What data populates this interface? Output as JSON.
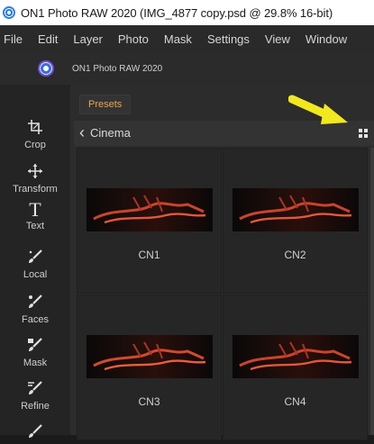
{
  "window": {
    "title": "ON1 Photo RAW 2020 (IMG_4877 copy.psd @ 29.8% 16-bit)"
  },
  "menu": {
    "items": [
      "File",
      "Edit",
      "Layer",
      "Photo",
      "Mask",
      "Settings",
      "View",
      "Window"
    ]
  },
  "app_header": {
    "name": "ON1 Photo RAW 2020"
  },
  "tools": [
    {
      "label": "Crop",
      "icon": "crop-icon"
    },
    {
      "label": "Transform",
      "icon": "transform-icon"
    },
    {
      "label": "Text",
      "icon": "text-icon"
    },
    {
      "label": "Local",
      "icon": "local-brush-icon"
    },
    {
      "label": "Faces",
      "icon": "faces-icon"
    },
    {
      "label": "Mask",
      "icon": "mask-brush-icon"
    },
    {
      "label": "Refine",
      "icon": "refine-brush-icon"
    }
  ],
  "panel": {
    "tab_label": "Presets",
    "category": "Cinema",
    "accent_color": "#e7a94a",
    "annotation_arrow_color": "#f2e81f"
  },
  "presets": [
    {
      "label": "CN1"
    },
    {
      "label": "CN2"
    },
    {
      "label": "CN3"
    },
    {
      "label": "CN4"
    }
  ]
}
